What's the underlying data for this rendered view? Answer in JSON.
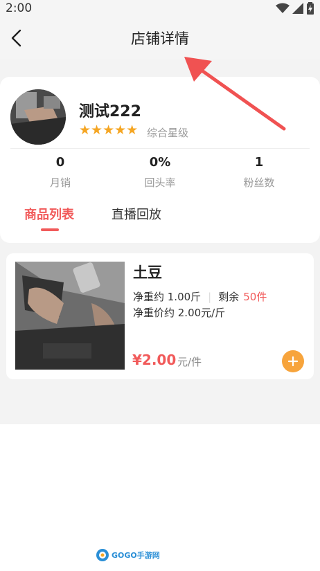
{
  "status_bar": {
    "time": "2:00"
  },
  "header": {
    "title": "店铺详情"
  },
  "shop": {
    "name": "测试222",
    "stars": "★★★★★",
    "rating_label": "综合星级",
    "stats": [
      {
        "value": "0",
        "label": "月销"
      },
      {
        "value": "0%",
        "label": "回头率"
      },
      {
        "value": "1",
        "label": "粉丝数"
      }
    ],
    "rating_stars_count": 5
  },
  "tabs": [
    {
      "label": "商品列表",
      "active": true
    },
    {
      "label": "直播回放",
      "active": false
    }
  ],
  "product": {
    "name": "土豆",
    "net_weight_label": "净重约 1.00斤",
    "stock_label": "剩余",
    "stock_value": "50件",
    "net_price_label": "净重价约 2.00元/斤",
    "price": "¥2.00",
    "price_unit": "元/件",
    "add_icon": "plus-icon"
  },
  "colors": {
    "accent_red": "#f15a5a",
    "star_orange": "#f5a623",
    "add_button_orange": "#f7a43c",
    "annotation_arrow": "#f05252"
  },
  "watermark": {
    "text": "GOGO手游网"
  }
}
